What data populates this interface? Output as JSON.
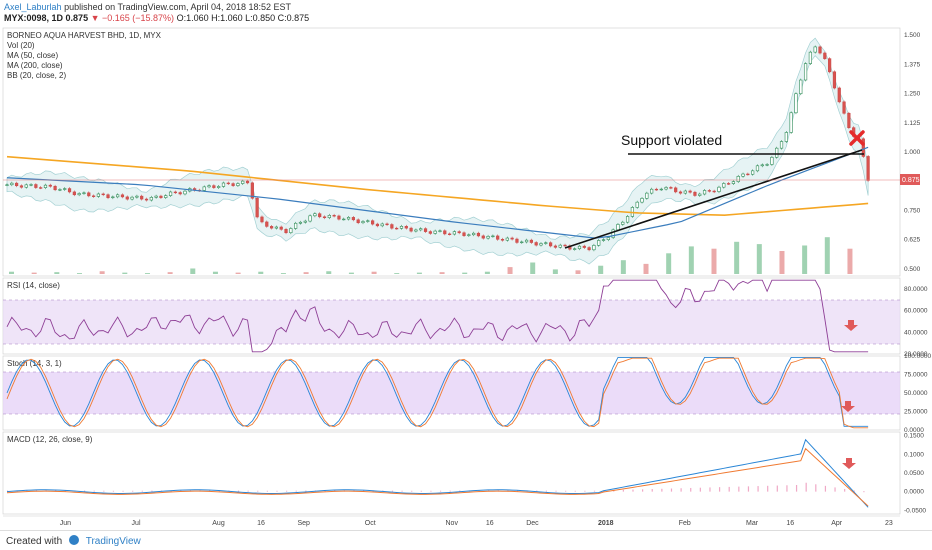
{
  "header": {
    "user": "Axel_Laburlah",
    "published": "published on TradingView.com, April 04, 2018 18:52 EST",
    "symbol": "MYX:0098, 1D",
    "price": "0.875",
    "change": "▼ −0.165 (−15.87%)",
    "ohlc": "O:1.060 H:1.060 L:0.850 C:0.875"
  },
  "main_pane": {
    "title": "BORNEO AQUA HARVEST BHD, 1D, MYX",
    "indicators": [
      "Vol (20)",
      "MA (50, close)",
      "MA (200, close)",
      "BB (20, close, 2)"
    ],
    "annotation": "Support violated",
    "price_tag": "0.875",
    "price_ticks": [
      "1.500",
      "1.375",
      "1.250",
      "1.125",
      "1.000",
      "0.875",
      "0.750",
      "0.625",
      "0.500"
    ]
  },
  "rsi_pane": {
    "title": "RSI (14, close)",
    "ticks": [
      "80.0000",
      "60.0000",
      "40.0000",
      "20.0000"
    ]
  },
  "stoch_pane": {
    "title": "Stoch (14, 3, 1)",
    "ticks": [
      "100.0000",
      "75.0000",
      "50.0000",
      "25.0000",
      "0.0000"
    ]
  },
  "macd_pane": {
    "title": "MACD (12, 26, close, 9)",
    "ticks": [
      "0.1500",
      "0.1000",
      "0.0500",
      "0.0000",
      "-0.0500"
    ]
  },
  "time_axis": [
    "Jun",
    "Jul",
    "Aug",
    "16",
    "Sep",
    "Oct",
    "Nov",
    "16",
    "Dec",
    "2018",
    "Feb",
    "Mar",
    "16",
    "Apr",
    "23"
  ],
  "footer": {
    "created_with": "Created with",
    "brand": "TradingView"
  },
  "chart_data": {
    "type": "candlestick",
    "title": "BORNEO AQUA HARVEST BHD, 1D, MYX",
    "ylim": [
      0.47,
      1.53
    ],
    "close_path": [
      [
        0.0,
        0.86
      ],
      [
        0.05,
        0.85
      ],
      [
        0.08,
        0.82
      ],
      [
        0.12,
        0.81
      ],
      [
        0.16,
        0.8
      ],
      [
        0.18,
        0.82
      ],
      [
        0.21,
        0.84
      ],
      [
        0.24,
        0.86
      ],
      [
        0.27,
        0.87
      ],
      [
        0.28,
        0.7
      ],
      [
        0.31,
        0.66
      ],
      [
        0.34,
        0.73
      ],
      [
        0.37,
        0.72
      ],
      [
        0.4,
        0.7
      ],
      [
        0.43,
        0.68
      ],
      [
        0.47,
        0.66
      ],
      [
        0.51,
        0.65
      ],
      [
        0.55,
        0.63
      ],
      [
        0.59,
        0.61
      ],
      [
        0.63,
        0.59
      ],
      [
        0.65,
        0.59
      ],
      [
        0.67,
        0.64
      ],
      [
        0.69,
        0.72
      ],
      [
        0.71,
        0.82
      ],
      [
        0.73,
        0.85
      ],
      [
        0.75,
        0.83
      ],
      [
        0.77,
        0.82
      ],
      [
        0.79,
        0.84
      ],
      [
        0.81,
        0.88
      ],
      [
        0.83,
        0.92
      ],
      [
        0.85,
        0.96
      ],
      [
        0.86,
        1.02
      ],
      [
        0.87,
        1.1
      ],
      [
        0.88,
        1.25
      ],
      [
        0.89,
        1.38
      ],
      [
        0.9,
        1.45
      ],
      [
        0.91,
        1.42
      ],
      [
        0.92,
        1.3
      ],
      [
        0.93,
        1.2
      ],
      [
        0.94,
        1.08
      ],
      [
        0.95,
        1.06
      ],
      [
        0.96,
        0.875
      ]
    ],
    "ma200_path": [
      [
        0.0,
        0.98
      ],
      [
        0.2,
        0.92
      ],
      [
        0.4,
        0.84
      ],
      [
        0.6,
        0.77
      ],
      [
        0.7,
        0.74
      ],
      [
        0.8,
        0.73
      ],
      [
        0.96,
        0.78
      ]
    ],
    "ma50_path": [
      [
        0.0,
        0.89
      ],
      [
        0.15,
        0.86
      ],
      [
        0.3,
        0.8
      ],
      [
        0.5,
        0.7
      ],
      [
        0.66,
        0.63
      ],
      [
        0.75,
        0.7
      ],
      [
        0.85,
        0.86
      ],
      [
        0.96,
        1.02
      ]
    ],
    "volume_heights": [
      0.05,
      0.03,
      0.04,
      0.02,
      0.06,
      0.03,
      0.02,
      0.04,
      0.12,
      0.05,
      0.03,
      0.05,
      0.02,
      0.04,
      0.06,
      0.03,
      0.05,
      0.02,
      0.03,
      0.04,
      0.03,
      0.05,
      0.15,
      0.25,
      0.1,
      0.08,
      0.18,
      0.3,
      0.22,
      0.45,
      0.6,
      0.55,
      0.7,
      0.65,
      0.5,
      0.62,
      0.8,
      0.55
    ],
    "rsi_range": [
      20,
      90
    ],
    "stoch_range": [
      0,
      100
    ],
    "macd_range": [
      -0.06,
      0.16
    ]
  }
}
